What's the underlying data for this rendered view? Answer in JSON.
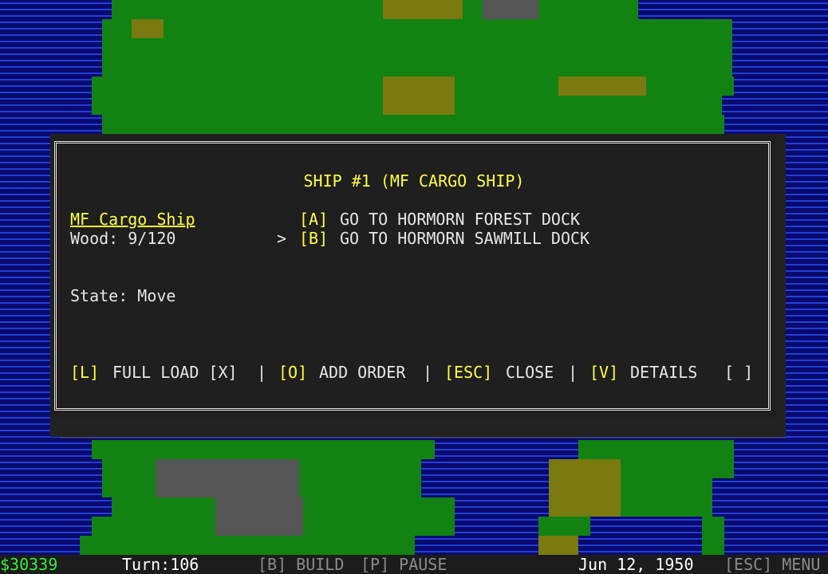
{
  "dialog": {
    "title": "SHIP #1 (MF CARGO SHIP)",
    "ship_name": "MF Cargo Ship",
    "cargo": "Wood: 9/120",
    "state": "State: Move",
    "orders": [
      {
        "key": "[A]",
        "label": "GO TO HORMORN FOREST DOCK",
        "selected": false
      },
      {
        "key": "[B]",
        "label": "GO TO HORMORN SAWMILL DOCK",
        "selected": true
      }
    ],
    "selected_marker": ">",
    "actions": [
      {
        "key": "[L]",
        "label": "FULL LOAD [X]"
      },
      {
        "key": "[O]",
        "label": "ADD ORDER"
      },
      {
        "key": "[ESC]",
        "label": "CLOSE"
      },
      {
        "key": "[V]",
        "label": "DETAILS"
      }
    ],
    "separator": "|",
    "checkbox": "[ ]"
  },
  "status_bar": {
    "money": "$30339",
    "turn": "Turn:106",
    "build": "[B] BUILD",
    "pause": "[P] PAUSE",
    "date": "Jun 12, 1950",
    "menu": "[ESC] MENU"
  },
  "colors": {
    "highlight": "#ffff40",
    "money": "#33ee33",
    "water": "#1f3fd8",
    "grass": "#128212"
  }
}
